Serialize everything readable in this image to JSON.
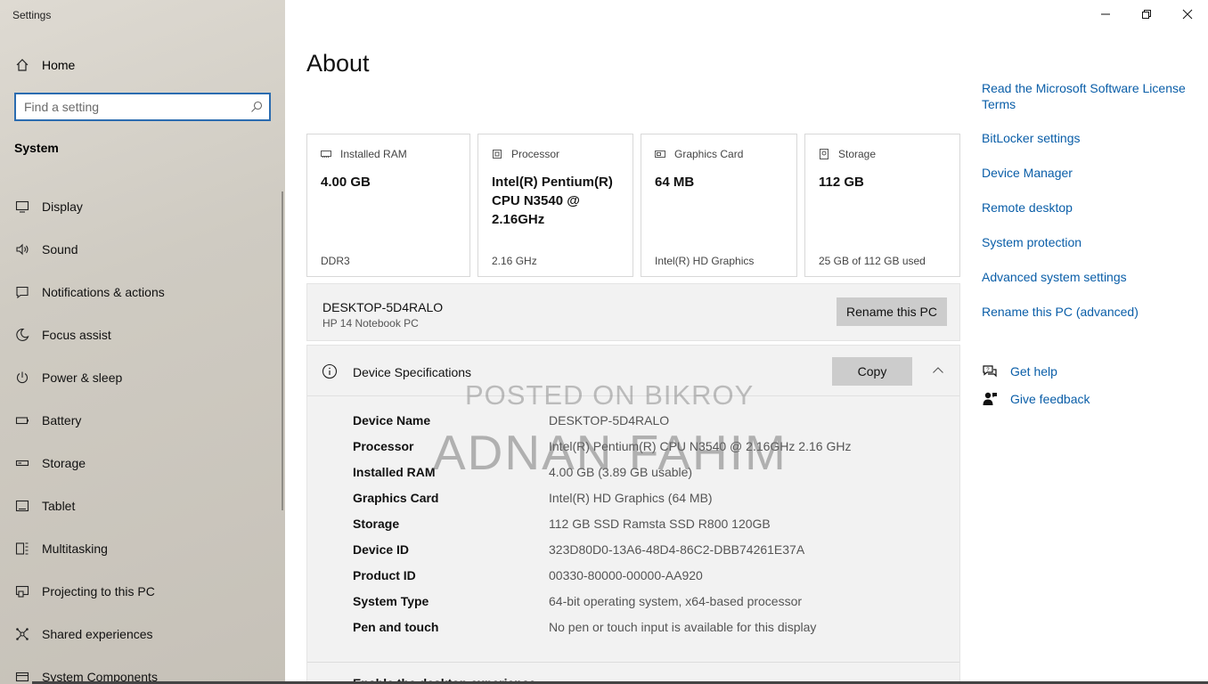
{
  "window": {
    "title": "Settings",
    "controls": {
      "minimize": "minimize-icon",
      "restore": "restore-icon",
      "close": "close-icon"
    }
  },
  "sidebar": {
    "home_label": "Home",
    "search_placeholder": "Find a setting",
    "section_heading": "System",
    "items": [
      {
        "label": "Display",
        "icon": "display-icon"
      },
      {
        "label": "Sound",
        "icon": "sound-icon"
      },
      {
        "label": "Notifications & actions",
        "icon": "notifications-icon"
      },
      {
        "label": "Focus assist",
        "icon": "moon-icon"
      },
      {
        "label": "Power & sleep",
        "icon": "power-icon"
      },
      {
        "label": "Battery",
        "icon": "battery-icon"
      },
      {
        "label": "Storage",
        "icon": "storage-icon"
      },
      {
        "label": "Tablet",
        "icon": "tablet-icon"
      },
      {
        "label": "Multitasking",
        "icon": "multitasking-icon"
      },
      {
        "label": "Projecting to this PC",
        "icon": "projecting-icon"
      },
      {
        "label": "Shared experiences",
        "icon": "shared-icon"
      },
      {
        "label": "System Components",
        "icon": "components-icon"
      }
    ]
  },
  "main": {
    "title": "About",
    "cards": [
      {
        "label": "Installed RAM",
        "value": "4.00 GB",
        "sub": "DDR3",
        "icon": "ram-icon"
      },
      {
        "label": "Processor",
        "value": "Intel(R) Pentium(R) CPU  N3540  @ 2.16GHz",
        "sub": "2.16 GHz",
        "icon": "processor-icon"
      },
      {
        "label": "Graphics Card",
        "value": "64 MB",
        "sub": "Intel(R) HD Graphics",
        "icon": "graphics-icon"
      },
      {
        "label": "Storage",
        "value": "112 GB",
        "sub": "25 GB of 112 GB used",
        "icon": "disk-icon"
      }
    ],
    "pc": {
      "name": "DESKTOP-5D4RALO",
      "model": "HP 14 Notebook PC",
      "rename_label": "Rename this PC"
    },
    "spec": {
      "title": "Device Specifications",
      "copy_label": "Copy",
      "rows": [
        {
          "key": "Device Name",
          "value": "DESKTOP-5D4RALO"
        },
        {
          "key": "Processor",
          "value": "Intel(R) Pentium(R) CPU  N3540  @ 2.16GHz   2.16 GHz"
        },
        {
          "key": "Installed RAM",
          "value": "4.00 GB (3.89 GB usable)"
        },
        {
          "key": "Graphics Card",
          "value": "Intel(R) HD Graphics (64 MB)"
        },
        {
          "key": "Storage",
          "value": "112 GB SSD Ramsta SSD R800 120GB"
        },
        {
          "key": "Device ID",
          "value": "323D80D0-13A6-48D4-86C2-DBB74261E37A"
        },
        {
          "key": "Product ID",
          "value": "00330-80000-00000-AA920"
        },
        {
          "key": "System Type",
          "value": "64-bit operating system, x64-based processor"
        },
        {
          "key": "Pen and touch",
          "value": "No pen or touch input is available for this display"
        }
      ],
      "next_section_partial": "Enable the desktop experience"
    }
  },
  "related": {
    "links": [
      "Read the Microsoft Software License Terms",
      "BitLocker settings",
      "Device Manager",
      "Remote desktop",
      "System protection",
      "Advanced system settings",
      "Rename this PC (advanced)"
    ],
    "help": {
      "label": "Get help",
      "icon": "help-chat-icon"
    },
    "feedback": {
      "label": "Give feedback",
      "icon": "feedback-person-icon"
    }
  },
  "watermark": {
    "line1": "POSTED ON BIKROY",
    "line2": "ADNAN FAHIM"
  },
  "colors": {
    "link": "#0a5ea8",
    "button": "#cccccc",
    "panel": "#f2f2f2",
    "search_border": "#2b6cb0"
  }
}
